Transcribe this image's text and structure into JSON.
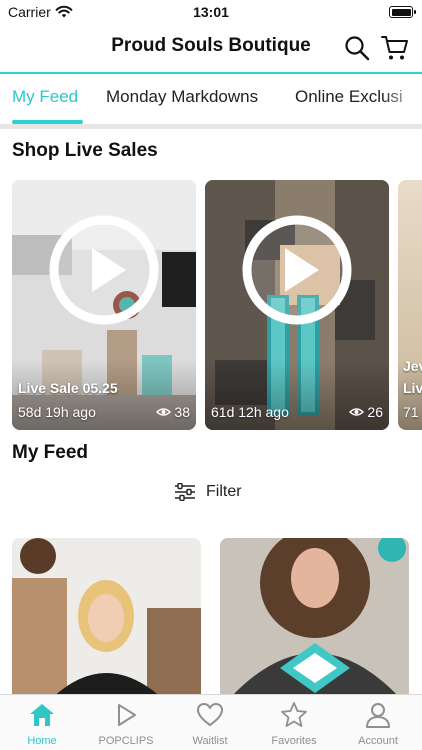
{
  "status_bar": {
    "carrier": "Carrier",
    "time": "13:01"
  },
  "header": {
    "title": "Proud Souls Boutique"
  },
  "tabs": [
    {
      "label": "My Feed",
      "active": true
    },
    {
      "label": "Monday Markdowns",
      "active": false
    },
    {
      "label": "Online Exclusi",
      "active": false
    }
  ],
  "live_sales": {
    "title": "Shop Live Sales",
    "cards": [
      {
        "title": "Live Sale 05.25",
        "age": "58d 19h ago",
        "views": "38"
      },
      {
        "title": "",
        "age": "61d 12h ago",
        "views": "26"
      },
      {
        "title": "Jev",
        "subtitle": "Liv",
        "age": "71"
      }
    ]
  },
  "feed": {
    "title": "My Feed",
    "filter_label": "Filter"
  },
  "bottom_nav": [
    {
      "label": "Home",
      "icon": "home-icon",
      "active": true
    },
    {
      "label": "POPCLIPS",
      "icon": "play-icon",
      "active": false
    },
    {
      "label": "Waitlist",
      "icon": "heart-icon",
      "active": false
    },
    {
      "label": "Favorites",
      "icon": "star-icon",
      "active": false
    },
    {
      "label": "Account",
      "icon": "person-icon",
      "active": false
    }
  ],
  "colors": {
    "accent": "#2fc6c6",
    "inactive": "#8e8e93"
  }
}
